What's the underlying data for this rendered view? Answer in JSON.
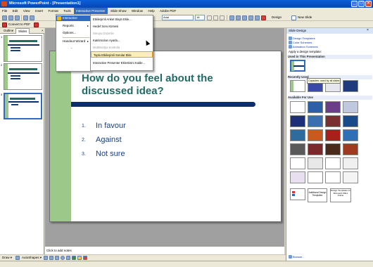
{
  "window": {
    "title": "Microsoft PowerPoint - [Presentation1]"
  },
  "menu": [
    "File",
    "Edit",
    "View",
    "Insert",
    "Format",
    "Tools",
    "Interactive Presenter",
    "Slide Show",
    "Window",
    "Help",
    "Adobe PDF"
  ],
  "toolbar": {
    "font_name": "Arial",
    "font_size": "18",
    "design_label": "Design",
    "new_slide_label": "New Slide",
    "convert_pdf_label": "Convert to PDF"
  },
  "interactive_presenter_menu": [
    {
      "label": "Interactive Presenter",
      "arrow": "▸"
    },
    {
      "label": "Reports",
      "arrow": "▸"
    },
    {
      "label": "Options..."
    },
    {
      "label": "Handout Wizard",
      "arrow": "▸"
    }
  ],
  "submenu": [
    {
      "label": "Etkileşimli Anket Slaytı Ekle...",
      "disabled": false
    },
    {
      "label": "Hedef Soru Kümesi",
      "disabled": false
    },
    {
      "label": "Soruyu Düzenle",
      "disabled": true
    },
    {
      "label": "Katılımcıları Ayarla...",
      "disabled": false
    },
    {
      "label": "Multimedya Kontrolü",
      "disabled": true
    },
    {
      "label": "Toplu Etkileşimli Sorular Ekle",
      "disabled": false
    },
    {
      "label": "Interactive Presenter Eklentisini Kaldır...",
      "disabled": false
    }
  ],
  "left_pane": {
    "tabs": [
      "Outline",
      "Slides"
    ],
    "thumb_numbers": [
      "1",
      "2",
      "3"
    ]
  },
  "slide": {
    "title": "How do you feel about the discussed idea?",
    "bullets": [
      {
        "num": "1.",
        "text": "In favour"
      },
      {
        "num": "2.",
        "text": "Against"
      },
      {
        "num": "3.",
        "text": "Not sure"
      }
    ]
  },
  "notes_placeholder": "Click to add notes",
  "draw_toolbar": {
    "draw_label": "Draw ▾",
    "autoshapes_label": "AutoShapes ▾"
  },
  "task_pane": {
    "title": "Slide Design",
    "links": [
      "Design Templates",
      "Color Schemes",
      "Animation Schemes"
    ],
    "apply_label": "Apply a design template:",
    "section_used": "Used in This Presentation",
    "section_recent": "Recently Used",
    "section_available": "Available For Use",
    "tooltip": "Capsules: used by all slides",
    "additional_templates": "Additional Design Templates",
    "design_online": "Design Templates on Microsoft Office Online",
    "browse_label": "Browse..."
  },
  "colors": {
    "title_teal": "#1f6b66",
    "bullet_blue": "#1c3f80",
    "navy_bar": "#0c2e6d",
    "green_bar": "#9cc98a",
    "xp_titlebar": "#0a5fd8"
  }
}
